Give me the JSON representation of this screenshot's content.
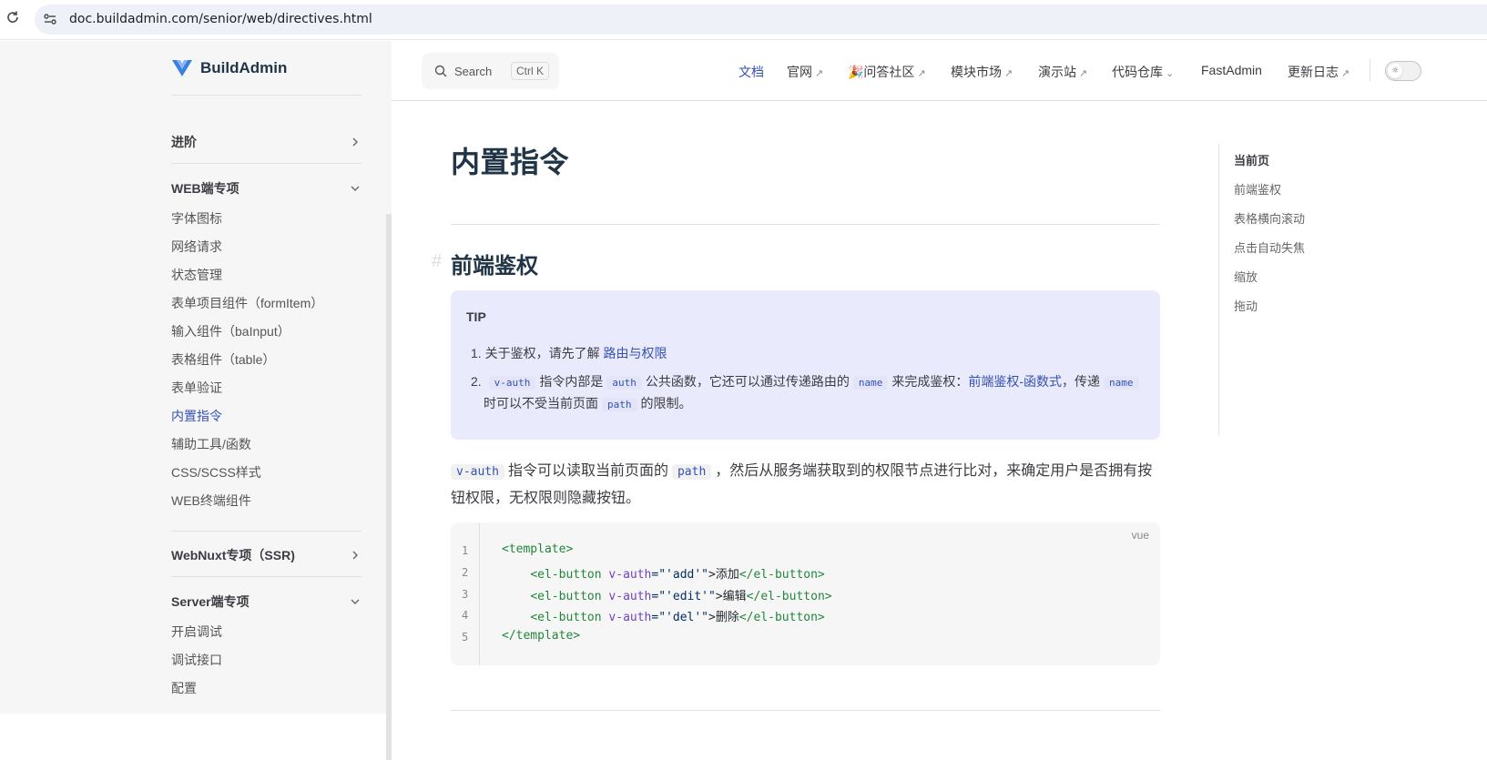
{
  "browser": {
    "url": "doc.buildadmin.com/senior/web/directives.html"
  },
  "sidebar": {
    "logo": "BuildAdmin",
    "groups": [
      {
        "label": "进阶"
      },
      {
        "label": "WEB端专项"
      },
      {
        "label": "WebNuxt专项（SSR)"
      },
      {
        "label": "Server端专项"
      }
    ],
    "web_items": [
      "字体图标",
      "网络请求",
      "状态管理",
      "表单项目组件（formItem）",
      "输入组件（baInput）",
      "表格组件（table）",
      "表单验证",
      "内置指令",
      "辅助工具/函数",
      "CSS/SCSS样式",
      "WEB终端组件"
    ],
    "server_items": [
      "开启调试",
      "调试接口",
      "配置"
    ]
  },
  "nav": {
    "search_label": "Search",
    "search_key": "Ctrl K",
    "items": [
      "文档",
      "官网",
      "🎉问答社区",
      "模块市场",
      "演示站",
      "代码仓库",
      "FastAdmin",
      "更新日志"
    ]
  },
  "content": {
    "title": "内置指令",
    "h2": "前端鉴权",
    "tip": {
      "title": "TIP",
      "line1_prefix": "1. 关于鉴权，请先了解",
      "line1_link": "路由与权限",
      "line2_num": "2.",
      "line2_code1": "v-auth",
      "line2_text1": "指令内部是",
      "line2_code2": "auth",
      "line2_text2": "公共函数，它还可以通过传递路由的",
      "line2_code3": "name",
      "line2_text3": "来完成鉴权：",
      "line2_link": "前端鉴权-函数式",
      "line2_text4": "，传递",
      "line2_code4": "name",
      "line3_text1": "时可以不受当前页面",
      "line3_code": "path",
      "line3_text2": "的限制。"
    },
    "para": {
      "code1": "v-auth",
      "text1": "指令可以读取当前页面的",
      "code2": "path",
      "text2": "，然后从服务端获取到的权限节点进行比对，来确定用户是否拥有按",
      "text3": "钮权限，无权限则隐藏按钮。"
    },
    "code": {
      "lang": "vue",
      "line_numbers": [
        "1",
        "2",
        "3",
        "4",
        "5"
      ],
      "l1_open": "<template>",
      "l2_tag": "<el-button",
      "l2_attr": " v-auth",
      "l2_str": "=\"'add'\"",
      "l2_text": ">添加",
      "l2_close": "</el-button>",
      "l3_tag": "<el-button",
      "l3_attr": " v-auth",
      "l3_str": "=\"'edit'\"",
      "l3_text": ">编辑",
      "l3_close": "</el-button>",
      "l4_tag": "<el-button",
      "l4_attr": " v-auth",
      "l4_str": "=\"'del'\"",
      "l4_text": ">删除",
      "l4_close": "</el-button>",
      "l5_close": "</template>"
    }
  },
  "toc": {
    "title": "当前页",
    "items": [
      "前端鉴权",
      "表格横向滚动",
      "点击自动失焦",
      "缩放",
      "拖动"
    ]
  },
  "colors": {
    "accent": "#3451b2",
    "tip_bg": "#eaeafd",
    "sidebar_bg": "#f6f6f7"
  }
}
